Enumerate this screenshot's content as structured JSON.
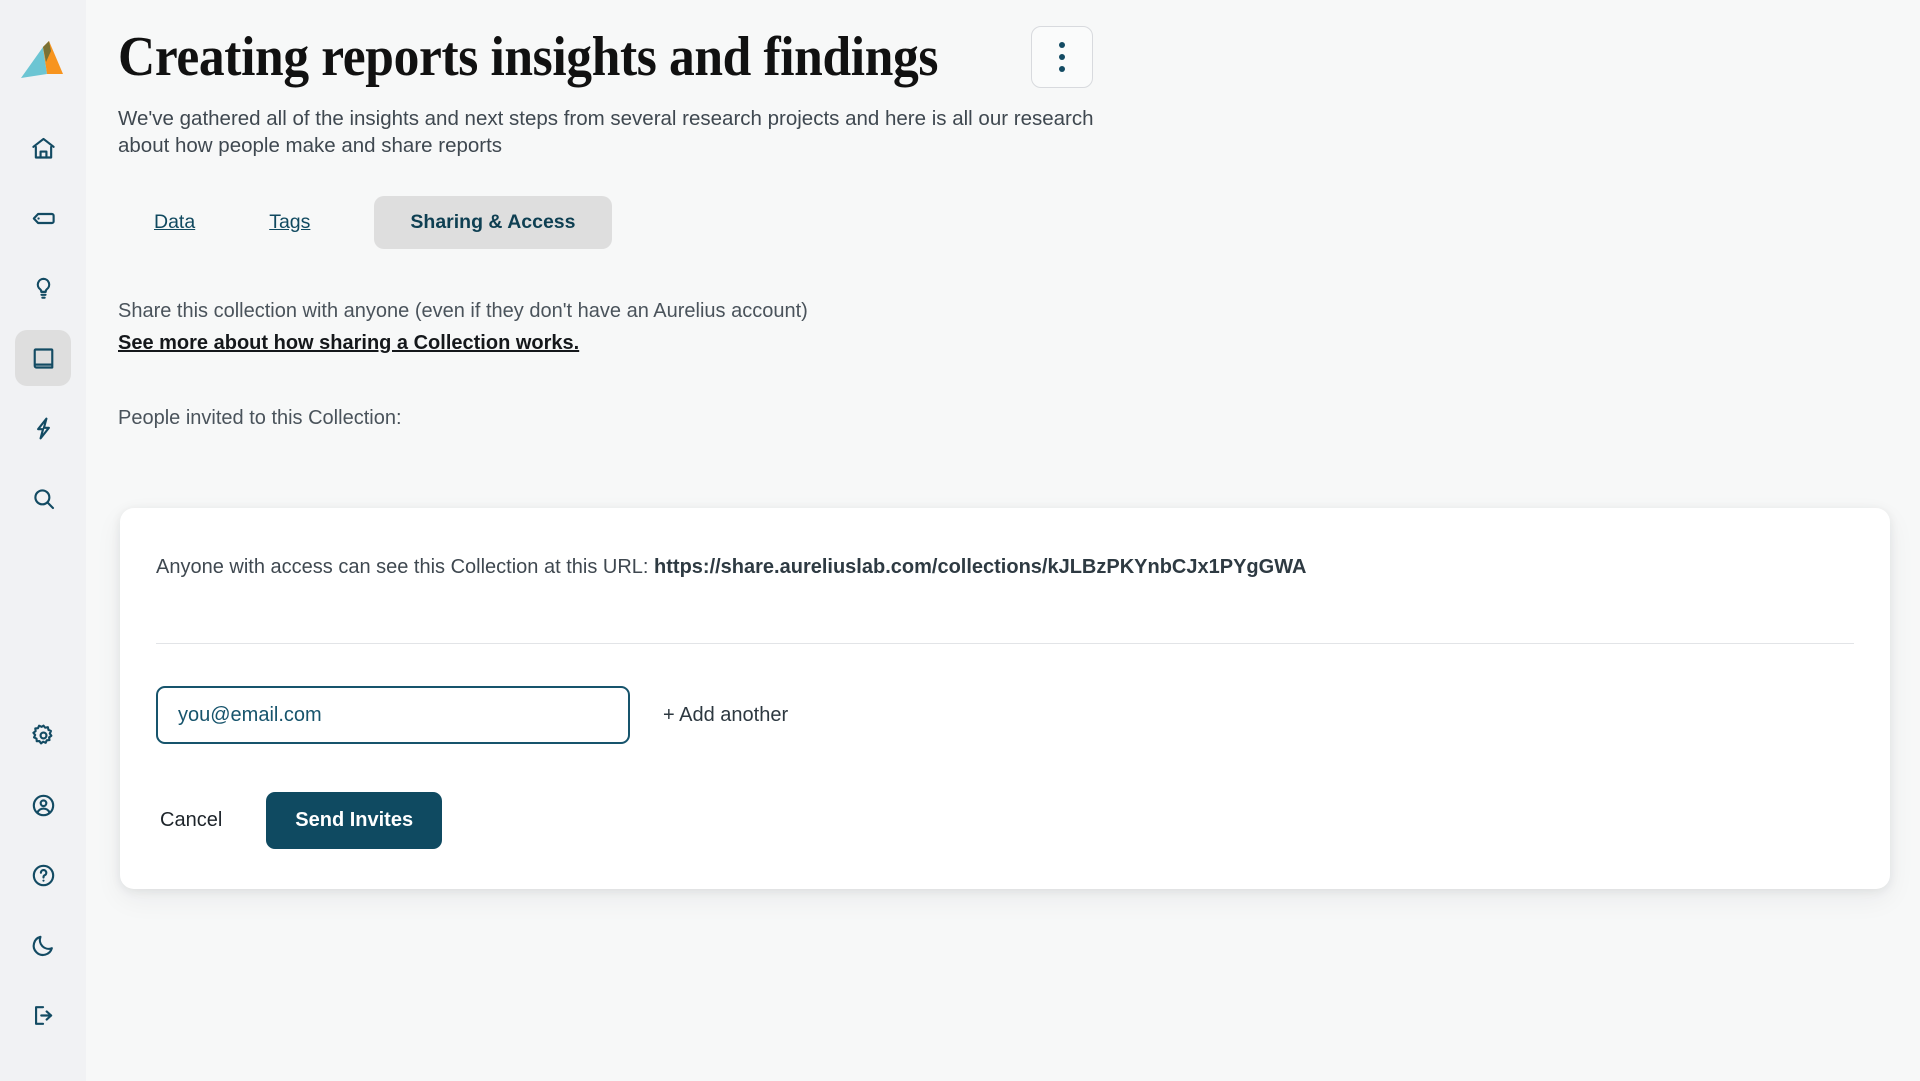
{
  "brand": {
    "logo_name": "aurelius-logo",
    "logo_colors": {
      "left": "#6cc5d3",
      "middle": "#7a7134",
      "right": "#f7941e"
    },
    "accent": "#0f4a61",
    "active_tab_bg": "#dedede"
  },
  "sidebar": {
    "items": [
      {
        "name": "home-icon",
        "label": "Home"
      },
      {
        "name": "tag-icon",
        "label": "Tags"
      },
      {
        "name": "lightbulb-icon",
        "label": "Insights"
      },
      {
        "name": "book-icon",
        "label": "Collections",
        "active": true
      },
      {
        "name": "lightning-icon",
        "label": "Activity"
      },
      {
        "name": "search-icon",
        "label": "Search"
      }
    ],
    "bottom_items": [
      {
        "name": "gear-icon",
        "label": "Settings"
      },
      {
        "name": "profile-icon",
        "label": "Account"
      },
      {
        "name": "help-icon",
        "label": "Help"
      },
      {
        "name": "moon-icon",
        "label": "Dark mode"
      },
      {
        "name": "logout-icon",
        "label": "Log out"
      }
    ]
  },
  "header": {
    "title": "Creating reports insights and findings",
    "subtitle": "We've gathered all of the insights and next steps from several research projects and here is all our research about how people make and share reports",
    "menu_label": "More options"
  },
  "tabs": [
    {
      "label": "Data",
      "active": false
    },
    {
      "label": "Tags",
      "active": false
    },
    {
      "label": "Sharing & Access",
      "active": true
    }
  ],
  "sharing": {
    "description": "Share this collection with anyone (even if they don't have an Aurelius account)",
    "help_link": "See more about how sharing a Collection works.",
    "invited_label": "People invited to this Collection:"
  },
  "card": {
    "url_prefix": "Anyone with access can see this Collection at this URL:",
    "url": "https://share.aureliuslab.com/collections/kJLBzPKYnbCJx1PYgGWA",
    "email_placeholder": "you@email.com",
    "email_value": "",
    "add_another_label": "+ Add another",
    "cancel_label": "Cancel",
    "send_label": "Send Invites"
  }
}
